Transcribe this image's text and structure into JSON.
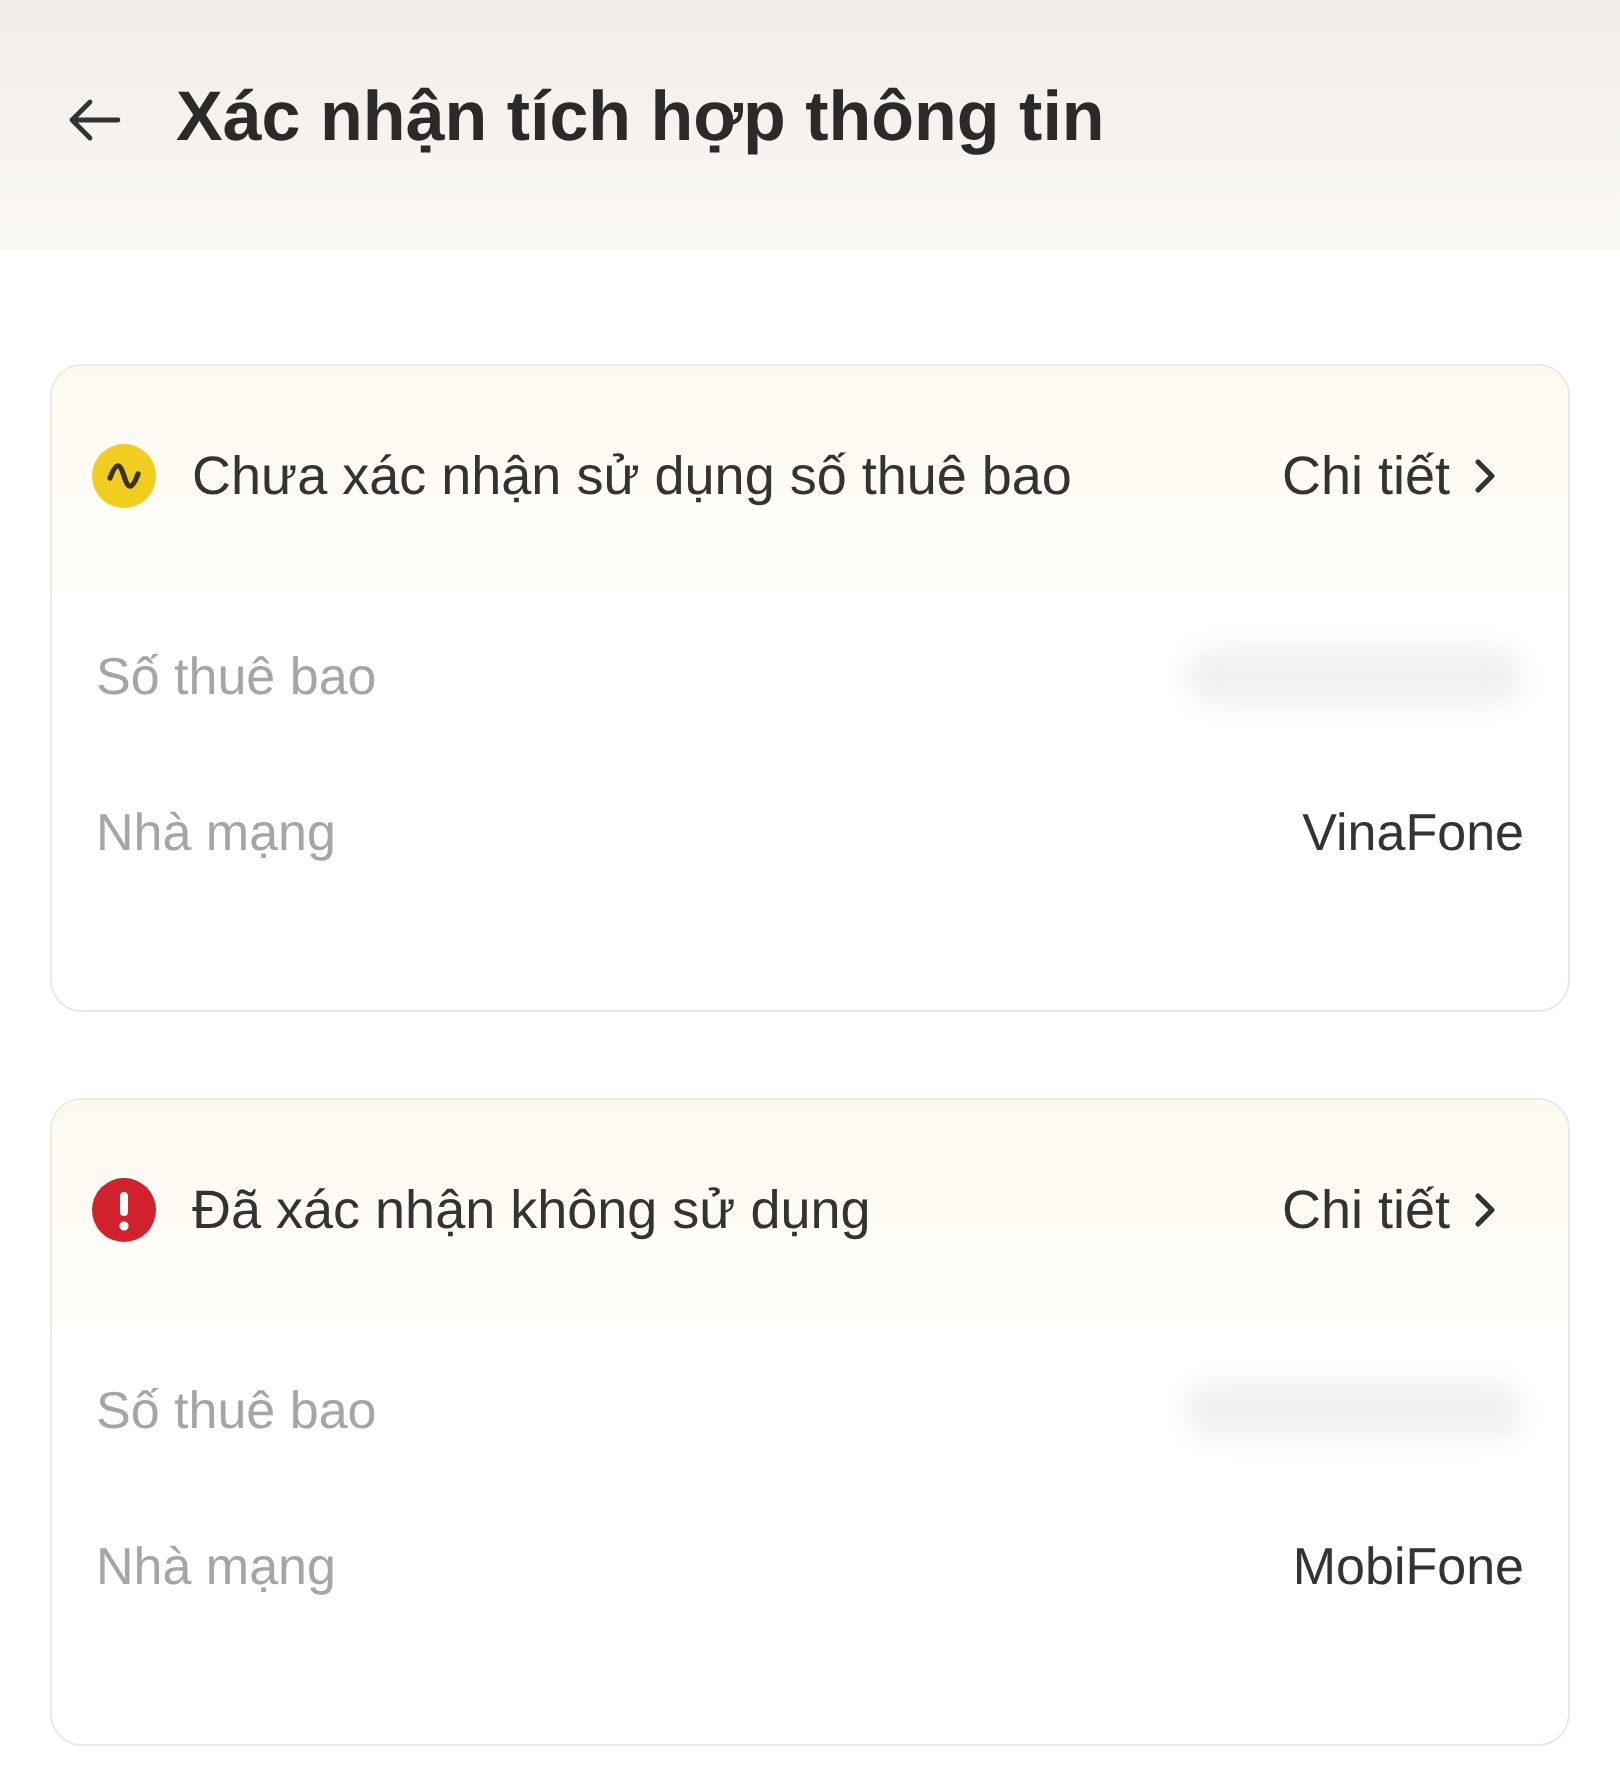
{
  "header": {
    "title": "Xác nhận tích hợp thông tin"
  },
  "cards": [
    {
      "status": {
        "kind": "pending",
        "label": "Chưa xác nhận sử dụng số thuê bao"
      },
      "detail_link": "Chi tiết",
      "rows": [
        {
          "label": "Số thuê bao",
          "kind": "hidden"
        },
        {
          "label": "Nhà mạng",
          "kind": "text",
          "value": "VinaFone"
        }
      ]
    },
    {
      "status": {
        "kind": "rejected",
        "label": "Đã xác nhận không sử dụng"
      },
      "detail_link": "Chi tiết",
      "rows": [
        {
          "label": "Số thuê bao",
          "kind": "hidden"
        },
        {
          "label": "Nhà mạng",
          "kind": "text",
          "value": "MobiFone"
        }
      ]
    }
  ]
}
